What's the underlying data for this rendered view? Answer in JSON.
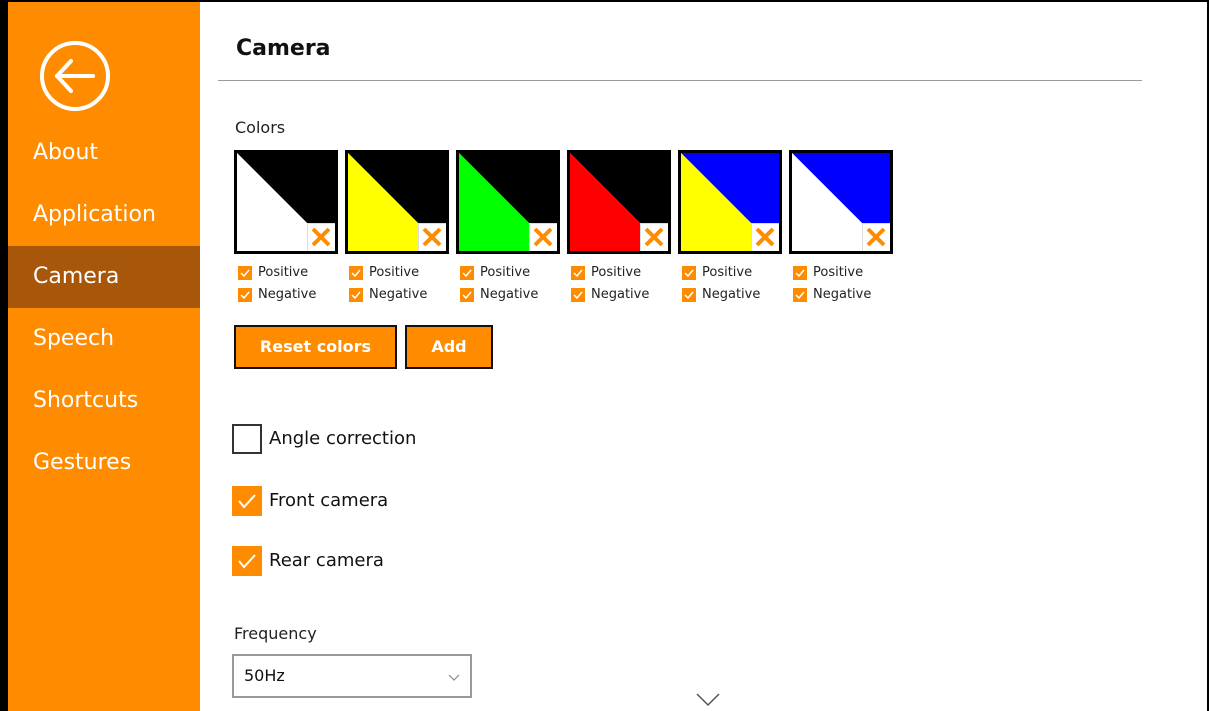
{
  "sidebar": {
    "back_icon": "circle-arrow-left-icon",
    "items": [
      {
        "label": "About"
      },
      {
        "label": "Application"
      },
      {
        "label": "Camera"
      },
      {
        "label": "Speech"
      },
      {
        "label": "Shortcuts"
      },
      {
        "label": "Gestures"
      }
    ],
    "active_index": 2
  },
  "page": {
    "title": "Camera"
  },
  "colors": {
    "label": "Colors",
    "swatches": [
      {
        "positive_color": "#ffffff",
        "negative_color": "#000000",
        "positive_label": "Positive",
        "negative_label": "Negative",
        "positive_checked": true,
        "negative_checked": true
      },
      {
        "positive_color": "#ffff00",
        "negative_color": "#000000",
        "positive_label": "Positive",
        "negative_label": "Negative",
        "positive_checked": true,
        "negative_checked": true
      },
      {
        "positive_color": "#00ff00",
        "negative_color": "#000000",
        "positive_label": "Positive",
        "negative_label": "Negative",
        "positive_checked": true,
        "negative_checked": true
      },
      {
        "positive_color": "#ff0000",
        "negative_color": "#000000",
        "positive_label": "Positive",
        "negative_label": "Negative",
        "positive_checked": true,
        "negative_checked": true
      },
      {
        "positive_color": "#ffff00",
        "negative_color": "#0000ff",
        "positive_label": "Positive",
        "negative_label": "Negative",
        "positive_checked": true,
        "negative_checked": true
      },
      {
        "positive_color": "#ffffff",
        "negative_color": "#0000ff",
        "positive_label": "Positive",
        "negative_label": "Negative",
        "positive_checked": true,
        "negative_checked": true
      }
    ],
    "delete_icon": "close-x-icon",
    "reset_label": "Reset colors",
    "add_label": "Add"
  },
  "options": {
    "angle_correction": {
      "label": "Angle correction",
      "checked": false
    },
    "front_camera": {
      "label": "Front camera",
      "checked": true
    },
    "rear_camera": {
      "label": "Rear camera",
      "checked": true
    }
  },
  "frequency": {
    "label": "Frequency",
    "value": "50Hz"
  },
  "theme": {
    "accent": "#ff8c00",
    "sidebar_active": "#a8560a"
  }
}
